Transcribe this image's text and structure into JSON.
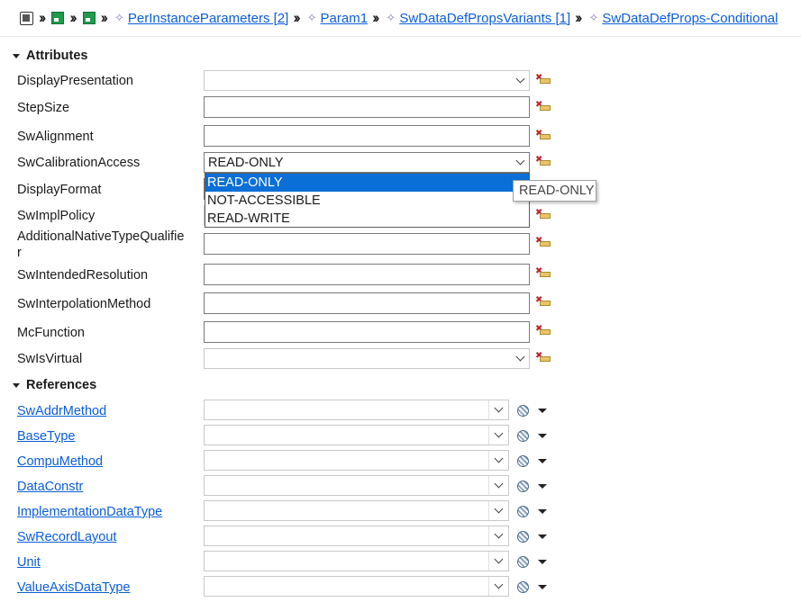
{
  "breadcrumb": {
    "items": [
      {
        "label": "PerInstanceParameters [2]"
      },
      {
        "label": "Param1"
      },
      {
        "label": "SwDataDefPropsVariants [1]"
      },
      {
        "label": "SwDataDefProps-Conditional"
      }
    ]
  },
  "attributes": {
    "title": "Attributes",
    "rows": [
      {
        "label": "DisplayPresentation",
        "kind": "combo",
        "value": ""
      },
      {
        "label": "StepSize",
        "kind": "text",
        "value": ""
      },
      {
        "label": "SwAlignment",
        "kind": "text",
        "value": ""
      },
      {
        "label": "SwCalibrationAccess",
        "kind": "combo",
        "value": "READ-ONLY"
      },
      {
        "label": "DisplayFormat",
        "kind": "text",
        "value": ""
      },
      {
        "label": "SwImplPolicy",
        "kind": "combo",
        "value": ""
      },
      {
        "label": "AdditionalNativeTypeQualifie",
        "label2": "r",
        "kind": "text",
        "value": ""
      },
      {
        "label": "SwIntendedResolution",
        "kind": "text",
        "value": ""
      },
      {
        "label": "SwInterpolationMethod",
        "kind": "text",
        "value": ""
      },
      {
        "label": "McFunction",
        "kind": "text",
        "value": ""
      },
      {
        "label": "SwIsVirtual",
        "kind": "combo",
        "value": ""
      }
    ]
  },
  "dropdown": {
    "options": [
      "READ-ONLY",
      "NOT-ACCESSIBLE",
      "READ-WRITE"
    ],
    "selected": "READ-ONLY"
  },
  "tooltip": {
    "text": "READ-ONLY"
  },
  "references": {
    "title": "References",
    "rows": [
      {
        "label": "SwAddrMethod",
        "value": ""
      },
      {
        "label": "BaseType",
        "value": ""
      },
      {
        "label": "CompuMethod",
        "value": ""
      },
      {
        "label": "DataConstr",
        "value": ""
      },
      {
        "label": "ImplementationDataType",
        "value": ""
      },
      {
        "label": "SwRecordLayout",
        "value": ""
      },
      {
        "label": "Unit",
        "value": ""
      },
      {
        "label": "ValueAxisDataType",
        "value": ""
      }
    ]
  },
  "icons": {
    "root": "model-root-icon",
    "package": "package-icon",
    "crumb": "diamond-icon",
    "clear": "clear-value-icon",
    "reference": "reference-globe-icon",
    "dropdown": "chevron-down-icon"
  },
  "colors": {
    "link": "#0b5ed7",
    "selection": "#0a6fd6",
    "clear_icon_x": "#c0282c"
  }
}
